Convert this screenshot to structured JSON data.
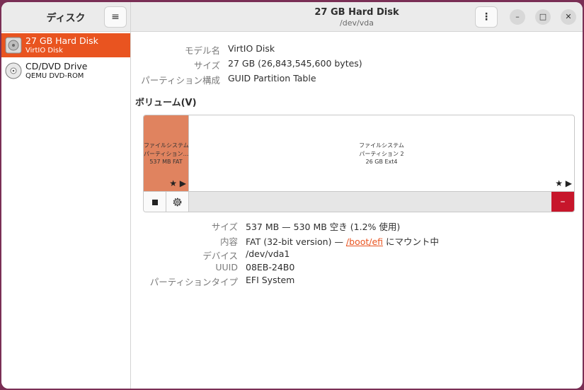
{
  "sidebar": {
    "title": "ディスク",
    "menu_icon": "hamburger-menu-icon",
    "drives": [
      {
        "name": "27 GB Hard Disk",
        "sub": "VirtIO Disk",
        "icon": "hard-disk-icon",
        "selected": true
      },
      {
        "name": "CD/DVD Drive",
        "sub": "QEMU DVD-ROM",
        "icon": "optical-disc-icon",
        "selected": false
      }
    ]
  },
  "header": {
    "title": "27 GB Hard Disk",
    "subtitle": "/dev/vda",
    "menu_icon": "kebab-menu-icon",
    "minimize": "–",
    "maximize": "□",
    "close": "✕"
  },
  "drive_info": {
    "model_label": "モデル名",
    "model_value": "VirtIO Disk",
    "size_label": "サイズ",
    "size_value": "27 GB (26,843,545,600 bytes)",
    "partitioning_label": "パーティション構成",
    "partitioning_value": "GUID Partition Table"
  },
  "volumes": {
    "title": "ボリューム(V)",
    "partitions": [
      {
        "line1": "ファイルシステム",
        "line2": "パーティション…",
        "line3": "537 MB FAT",
        "share": 0.02
      },
      {
        "line1": "ファイルシステム",
        "line2": "パーティション 2",
        "line3": "26 GB Ext4",
        "share": 0.98
      }
    ],
    "marks": "★ ▶",
    "toolbar": {
      "stop_icon": "stop-icon",
      "gear_icon": "gear-icon",
      "delete_label": "–"
    }
  },
  "partition_info": {
    "size_label": "サイズ",
    "size_value": "537 MB — 530 MB 空き (1.2% 使用)",
    "contents_label": "内容",
    "contents_prefix": "FAT (32-bit version) — ",
    "contents_link": "/boot/efi",
    "contents_suffix": " にマウント中",
    "device_label": "デバイス",
    "device_value": "/dev/vda1",
    "uuid_label": "UUID",
    "uuid_value": "08EB-24B0",
    "type_label": "パーティションタイプ",
    "type_value": "EFI System"
  },
  "colors": {
    "accent": "#e95420",
    "selected_partition": "#e0835f",
    "danger": "#c7162b"
  }
}
